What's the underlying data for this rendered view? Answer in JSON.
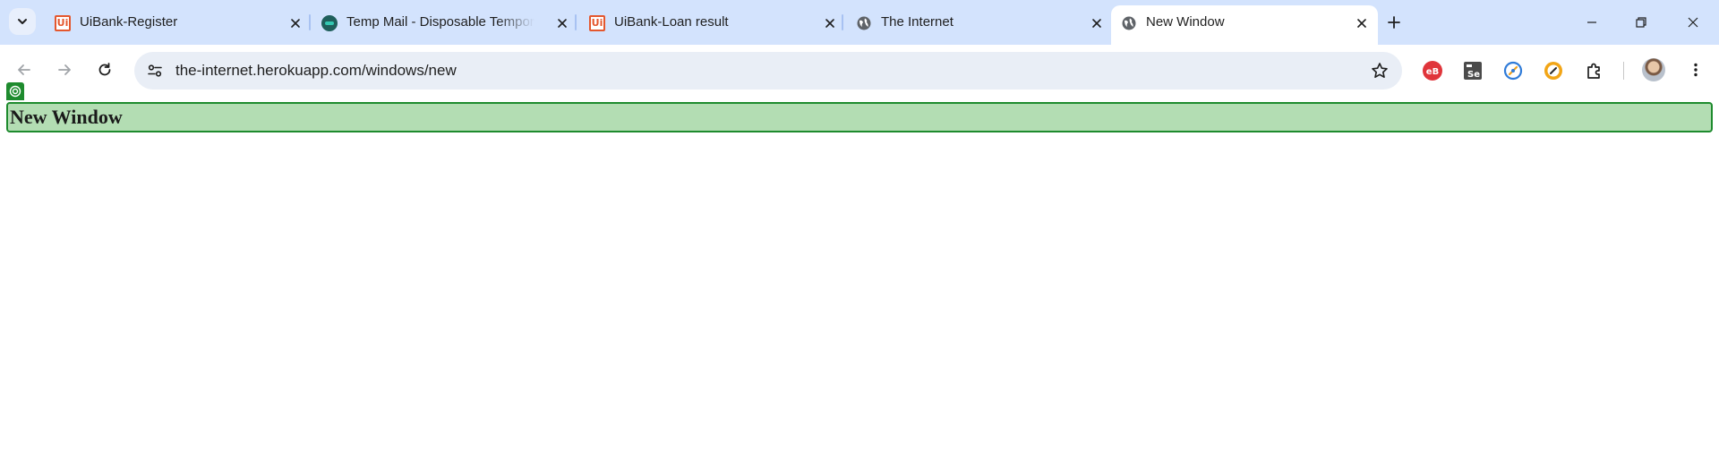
{
  "browser": {
    "tabs": [
      {
        "title": "UiBank-Register",
        "favicon": "uibank-logo",
        "active": false
      },
      {
        "title": "Temp Mail - Disposable Temporary Email",
        "favicon": "tempmail-logo",
        "active": false
      },
      {
        "title": "UiBank-Loan result",
        "favicon": "uibank-logo",
        "active": false
      },
      {
        "title": "The Internet",
        "favicon": "globe-icon",
        "active": false
      },
      {
        "title": "New Window",
        "favicon": "globe-icon",
        "active": true
      }
    ],
    "address_bar": {
      "url": "the-internet.herokuapp.com/windows/new"
    },
    "extensions": [
      "bitwarden-extension-icon",
      "selenium-ide-icon",
      "speedometer-blue-icon",
      "speedometer-orange-icon",
      "puzzle-icon"
    ],
    "colors": {
      "tabstrip": "#d3e3fd",
      "omnibox": "#e9eef6",
      "accent_green": "#1e8b2e",
      "highlight_green": "#b3ddb3"
    }
  },
  "page": {
    "heading": "New Window"
  }
}
